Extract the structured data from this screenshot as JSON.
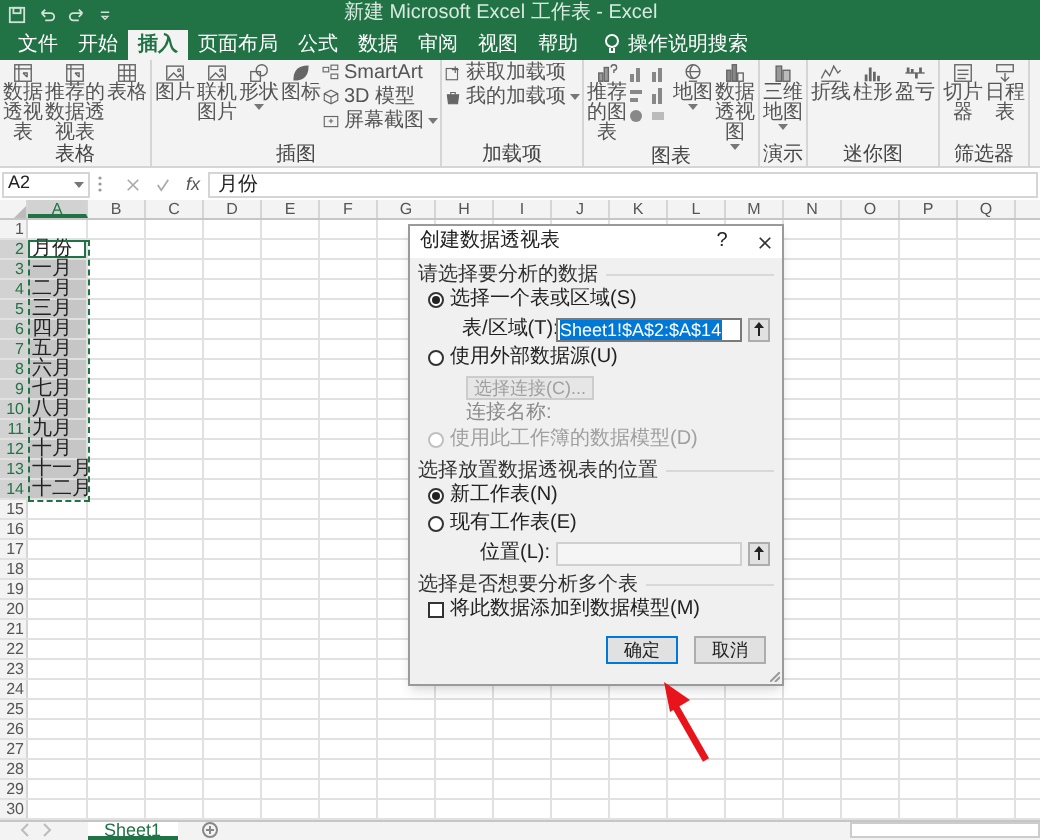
{
  "window": {
    "title": "新建 Microsoft Excel 工作表 - Excel"
  },
  "ribbon_tabs": [
    {
      "label": "文件",
      "selected": false
    },
    {
      "label": "开始",
      "selected": false
    },
    {
      "label": "插入",
      "selected": true
    },
    {
      "label": "页面布局",
      "selected": false
    },
    {
      "label": "公式",
      "selected": false
    },
    {
      "label": "数据",
      "selected": false
    },
    {
      "label": "审阅",
      "selected": false
    },
    {
      "label": "视图",
      "selected": false
    },
    {
      "label": "帮助",
      "selected": false
    }
  ],
  "tell_me": "操作说明搜索",
  "ribbon_groups": [
    {
      "label": "表格",
      "items": [
        {
          "kind": "large",
          "label": "数据透视表",
          "dropdown": false
        },
        {
          "kind": "large",
          "label": "推荐的数据透视表",
          "dropdown": false
        },
        {
          "kind": "large",
          "label": "表格",
          "dropdown": false
        }
      ]
    },
    {
      "label": "插图",
      "items": [
        {
          "kind": "large",
          "label": "图片",
          "dropdown": false
        },
        {
          "kind": "large",
          "label": "联机图片",
          "dropdown": false
        },
        {
          "kind": "large",
          "label": "形状",
          "dropdown": true
        },
        {
          "kind": "large",
          "label": "图标",
          "dropdown": false
        },
        {
          "kind": "small",
          "label": "SmartArt",
          "dropdown": false
        },
        {
          "kind": "small",
          "label": "3D 模型",
          "dropdown": false
        },
        {
          "kind": "small",
          "label": "屏幕截图",
          "dropdown": true
        }
      ]
    },
    {
      "label": "加载项",
      "items": [
        {
          "kind": "small",
          "label": "获取加载项",
          "dropdown": false
        },
        {
          "kind": "small",
          "label": "我的加载项",
          "dropdown": true
        }
      ]
    },
    {
      "label": "图表",
      "items": [
        {
          "kind": "large",
          "label": "推荐的图表",
          "dropdown": false
        },
        {
          "kind": "gallery"
        },
        {
          "kind": "large",
          "label": "地图",
          "dropdown": true
        },
        {
          "kind": "large",
          "label": "数据透视图",
          "dropdown": true
        }
      ]
    },
    {
      "label": "演示",
      "items": [
        {
          "kind": "large",
          "label": "三维地图",
          "dropdown": true
        }
      ]
    },
    {
      "label": "迷你图",
      "items": [
        {
          "kind": "large",
          "label": "折线",
          "dropdown": false
        },
        {
          "kind": "large",
          "label": "柱形",
          "dropdown": false
        },
        {
          "kind": "large",
          "label": "盈亏",
          "dropdown": false
        }
      ]
    },
    {
      "label": "筛选器",
      "items": [
        {
          "kind": "large",
          "label": "切片器",
          "dropdown": false
        },
        {
          "kind": "large",
          "label": "日程表",
          "dropdown": false
        }
      ]
    }
  ],
  "formula_bar": {
    "name_box": "A2",
    "function_label": "fx",
    "value": "月份"
  },
  "sheet": {
    "marquee": true,
    "columns": [
      {
        "label": "A",
        "selected": true
      },
      {
        "label": "B",
        "selected": false
      },
      {
        "label": "C",
        "selected": false
      },
      {
        "label": "D",
        "selected": false
      },
      {
        "label": "E",
        "selected": false
      },
      {
        "label": "F",
        "selected": false
      },
      {
        "label": "G",
        "selected": false
      },
      {
        "label": "H",
        "selected": false
      },
      {
        "label": "I",
        "selected": false
      },
      {
        "label": "J",
        "selected": false
      },
      {
        "label": "K",
        "selected": false
      },
      {
        "label": "L",
        "selected": false
      },
      {
        "label": "M",
        "selected": false
      },
      {
        "label": "N",
        "selected": false
      },
      {
        "label": "O",
        "selected": false
      },
      {
        "label": "P",
        "selected": false
      },
      {
        "label": "Q",
        "selected": false
      }
    ],
    "rows": [
      {
        "number": "1",
        "selected": false,
        "active": false
      },
      {
        "number": "2",
        "cell_a": "月份",
        "selected": true,
        "active": true
      },
      {
        "number": "3",
        "cell_a": "一月",
        "selected": true,
        "active": false
      },
      {
        "number": "4",
        "cell_a": "二月",
        "selected": true,
        "active": false
      },
      {
        "number": "5",
        "cell_a": "三月",
        "selected": true,
        "active": false
      },
      {
        "number": "6",
        "cell_a": "四月",
        "selected": true,
        "active": false
      },
      {
        "number": "7",
        "cell_a": "五月",
        "selected": true,
        "active": false
      },
      {
        "number": "8",
        "cell_a": "六月",
        "selected": true,
        "active": false
      },
      {
        "number": "9",
        "cell_a": "七月",
        "selected": true,
        "active": false
      },
      {
        "number": "10",
        "cell_a": "八月",
        "selected": true,
        "active": false
      },
      {
        "number": "11",
        "cell_a": "九月",
        "selected": true,
        "active": false
      },
      {
        "number": "12",
        "cell_a": "十月",
        "selected": true,
        "active": false
      },
      {
        "number": "13",
        "cell_a": "十一月",
        "selected": true,
        "active": false
      },
      {
        "number": "14",
        "cell_a": "十二月",
        "selected": true,
        "active": false
      },
      {
        "number": "15",
        "selected": false,
        "active": false
      },
      {
        "number": "16",
        "selected": false,
        "active": false
      },
      {
        "number": "17",
        "selected": false,
        "active": false
      },
      {
        "number": "18",
        "selected": false,
        "active": false
      },
      {
        "number": "19",
        "selected": false,
        "active": false
      },
      {
        "number": "20",
        "selected": false,
        "active": false
      },
      {
        "number": "21",
        "selected": false,
        "active": false
      },
      {
        "number": "22",
        "selected": false,
        "active": false
      },
      {
        "number": "23",
        "selected": false,
        "active": false
      },
      {
        "number": "24",
        "selected": false,
        "active": false
      },
      {
        "number": "25",
        "selected": false,
        "active": false
      },
      {
        "number": "26",
        "selected": false,
        "active": false
      },
      {
        "number": "27",
        "selected": false,
        "active": false
      },
      {
        "number": "28",
        "selected": false,
        "active": false
      },
      {
        "number": "29",
        "selected": false,
        "active": false
      },
      {
        "number": "30",
        "selected": false,
        "active": false
      }
    ]
  },
  "sheet_tabs": [
    {
      "label": "Sheet1",
      "selected": true
    }
  ],
  "dialog": {
    "title": "创建数据透视表",
    "help": "?",
    "sections": [
      {
        "heading": "请选择要分析的数据",
        "rows": [
          {
            "kind": "radio",
            "label": "选择一个表或区域(S)",
            "selected": true,
            "disabled": false
          },
          {
            "kind": "field",
            "label": "表/区域(T):",
            "value": "Sheet1!$A$2:$A$14",
            "disabled": false
          },
          {
            "kind": "radio",
            "label": "使用外部数据源(U)",
            "selected": false,
            "disabled": false
          },
          {
            "kind": "button",
            "label": "选择连接(C)...",
            "disabled": true
          },
          {
            "kind": "text",
            "label": "连接名称:"
          },
          {
            "kind": "radio",
            "label": "使用此工作簿的数据模型(D)",
            "selected": false,
            "disabled": true
          }
        ]
      },
      {
        "heading": "选择放置数据透视表的位置",
        "rows": [
          {
            "kind": "radio",
            "label": "新工作表(N)",
            "selected": true,
            "disabled": false
          },
          {
            "kind": "radio",
            "label": "现有工作表(E)",
            "selected": false,
            "disabled": false
          },
          {
            "kind": "field",
            "label": "位置(L):",
            "disabled": true
          }
        ]
      },
      {
        "heading": "选择是否想要分析多个表",
        "rows": [
          {
            "kind": "checkbox",
            "label": "将此数据添加到数据模型(M)",
            "checked": false
          }
        ]
      }
    ],
    "buttons": [
      {
        "label": "确定",
        "default": true
      },
      {
        "label": "取消",
        "default": false
      }
    ]
  }
}
